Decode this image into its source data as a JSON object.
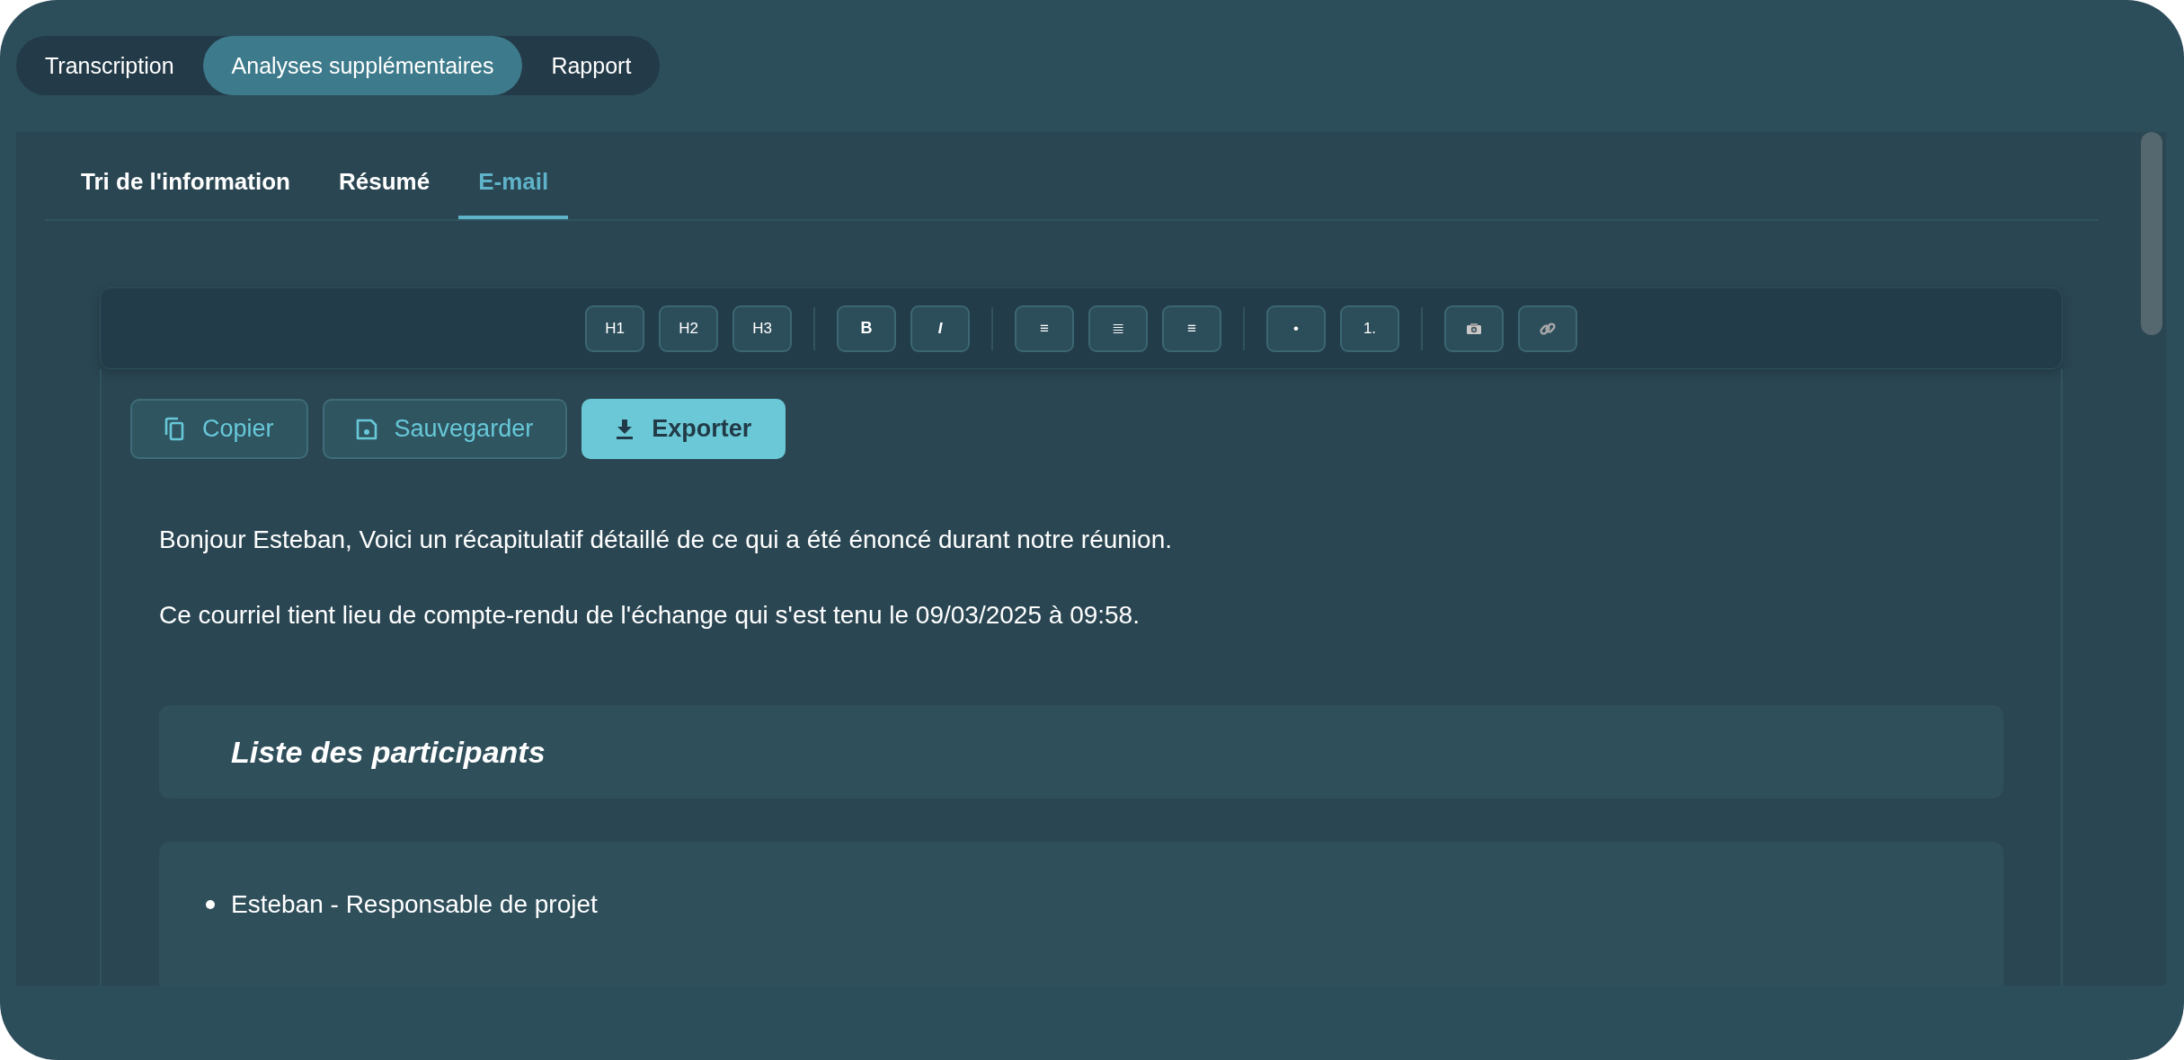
{
  "main_tabs": [
    {
      "label": "Transcription",
      "selected": false
    },
    {
      "label": "Analyses supplémentaires",
      "selected": true
    },
    {
      "label": "Rapport",
      "selected": false
    }
  ],
  "sub_tabs": [
    {
      "label": "Tri de l'information",
      "selected": false
    },
    {
      "label": "Résumé",
      "selected": false
    },
    {
      "label": "E-mail",
      "selected": true
    }
  ],
  "toolbar": [
    [
      {
        "kind": "text",
        "label": "H1"
      },
      {
        "kind": "text",
        "label": "H2"
      },
      {
        "kind": "text",
        "label": "H3"
      }
    ],
    [
      {
        "kind": "bold",
        "label": "B"
      },
      {
        "kind": "italic",
        "label": "I"
      }
    ],
    [
      {
        "kind": "text",
        "label": "≡"
      },
      {
        "kind": "text",
        "label": "≣"
      },
      {
        "kind": "text",
        "label": "≡"
      }
    ],
    [
      {
        "kind": "text",
        "label": "•"
      },
      {
        "kind": "text",
        "label": "1."
      }
    ],
    [
      {
        "kind": "camera"
      },
      {
        "kind": "link"
      }
    ]
  ],
  "actions": [
    {
      "kind": "copy",
      "label": "Copier",
      "primary": false
    },
    {
      "kind": "save",
      "label": "Sauvegarder",
      "primary": false
    },
    {
      "kind": "download",
      "label": "Exporter",
      "primary": true
    }
  ],
  "email": {
    "paragraphs": [
      "Bonjour Esteban, Voici un récapitulatif détaillé de ce qui a été énoncé durant notre réunion.",
      "Ce courriel tient lieu de compte-rendu de l'échange qui s'est tenu le 09/03/2025 à 09:58."
    ],
    "section_title": "Liste des participants",
    "participants": [
      "Esteban - Responsable de projet"
    ]
  }
}
